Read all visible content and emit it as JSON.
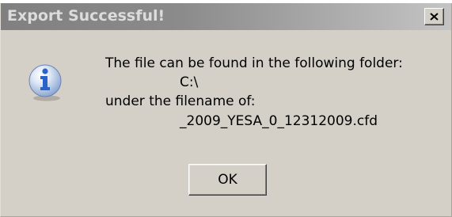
{
  "dialog": {
    "title": "Export Successful!",
    "message": {
      "line1": "The file can be found in the following folder:",
      "folder": "C:\\",
      "line3": "under the filename of:",
      "filename": "_2009_YESA_0_12312009.cfd"
    },
    "ok_label": "OK",
    "icon": "information-icon",
    "close_icon": "close-icon"
  },
  "colors": {
    "face": "#d4d0c8",
    "titlebar_start": "#808080",
    "titlebar_end": "#c4c4c4",
    "icon_blue": "#2a64c8"
  }
}
